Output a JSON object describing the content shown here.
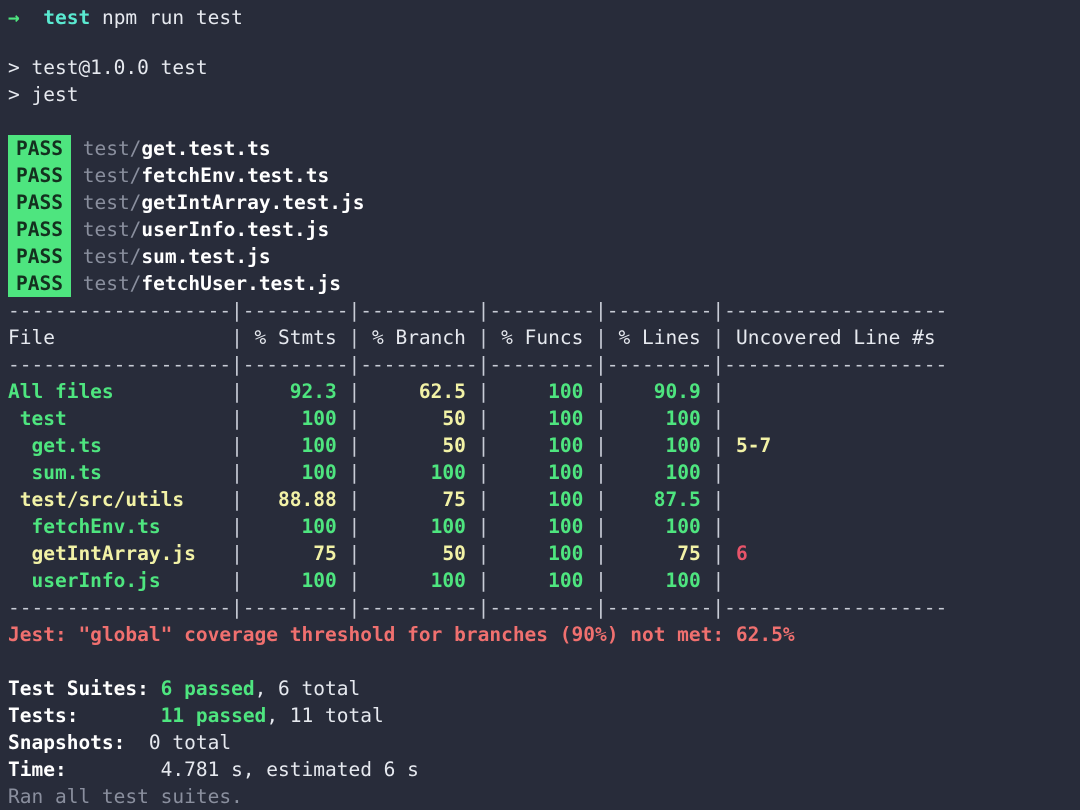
{
  "terminal": {
    "background_color": "#282c3a",
    "foreground_color": "#e6e9ef",
    "prompt": {
      "arrow_icon": "→",
      "cwd": "test",
      "command": "npm run test"
    },
    "npm_header": {
      "line1": "> test@1.0.0 test",
      "line2": "> jest"
    },
    "suites": [
      {
        "status": "PASS",
        "dir": "test/",
        "file": "get.test.ts"
      },
      {
        "status": "PASS",
        "dir": "test/",
        "file": "fetchEnv.test.ts"
      },
      {
        "status": "PASS",
        "dir": "test/",
        "file": "getIntArray.test.js"
      },
      {
        "status": "PASS",
        "dir": "test/",
        "file": "userInfo.test.js"
      },
      {
        "status": "PASS",
        "dir": "test/",
        "file": "sum.test.js"
      },
      {
        "status": "PASS",
        "dir": "test/",
        "file": "fetchUser.test.js"
      }
    ],
    "coverage_table": {
      "columns": [
        "File",
        "% Stmts",
        "% Branch",
        "% Funcs",
        "% Lines",
        "Uncovered Line #s"
      ],
      "separator_row": "-------------------|---------|----------|---------|---------|-------------------",
      "rows": [
        {
          "file": "All files",
          "indent": 0,
          "file_color": "green",
          "stmts": "92.3",
          "stmts_color": "green",
          "branch": "62.5",
          "branch_color": "yellow",
          "funcs": "100",
          "funcs_color": "green",
          "lines": "90.9",
          "lines_color": "green",
          "uncovered": "",
          "uncovered_color": "none"
        },
        {
          "file": "test",
          "indent": 1,
          "file_color": "green",
          "stmts": "100",
          "stmts_color": "green",
          "branch": "50",
          "branch_color": "yellow",
          "funcs": "100",
          "funcs_color": "green",
          "lines": "100",
          "lines_color": "green",
          "uncovered": "",
          "uncovered_color": "none"
        },
        {
          "file": "get.ts",
          "indent": 2,
          "file_color": "green",
          "stmts": "100",
          "stmts_color": "green",
          "branch": "50",
          "branch_color": "yellow",
          "funcs": "100",
          "funcs_color": "green",
          "lines": "100",
          "lines_color": "green",
          "uncovered": "5-7",
          "uncovered_color": "yellow"
        },
        {
          "file": "sum.ts",
          "indent": 2,
          "file_color": "green",
          "stmts": "100",
          "stmts_color": "green",
          "branch": "100",
          "branch_color": "green",
          "funcs": "100",
          "funcs_color": "green",
          "lines": "100",
          "lines_color": "green",
          "uncovered": "",
          "uncovered_color": "none"
        },
        {
          "file": "test/src/utils",
          "indent": 1,
          "file_color": "yellow",
          "stmts": "88.88",
          "stmts_color": "yellow",
          "branch": "75",
          "branch_color": "yellow",
          "funcs": "100",
          "funcs_color": "green",
          "lines": "87.5",
          "lines_color": "green",
          "uncovered": "",
          "uncovered_color": "none"
        },
        {
          "file": "fetchEnv.ts",
          "indent": 2,
          "file_color": "green",
          "stmts": "100",
          "stmts_color": "green",
          "branch": "100",
          "branch_color": "green",
          "funcs": "100",
          "funcs_color": "green",
          "lines": "100",
          "lines_color": "green",
          "uncovered": "",
          "uncovered_color": "none"
        },
        {
          "file": "getIntArray.js",
          "indent": 2,
          "file_color": "yellow",
          "stmts": "75",
          "stmts_color": "yellow",
          "branch": "50",
          "branch_color": "yellow",
          "funcs": "100",
          "funcs_color": "green",
          "lines": "75",
          "lines_color": "yellow",
          "uncovered": "6",
          "uncovered_color": "red"
        },
        {
          "file": "userInfo.js",
          "indent": 2,
          "file_color": "green",
          "stmts": "100",
          "stmts_color": "green",
          "branch": "100",
          "branch_color": "green",
          "funcs": "100",
          "funcs_color": "green",
          "lines": "100",
          "lines_color": "green",
          "uncovered": "",
          "uncovered_color": "none"
        }
      ]
    },
    "threshold_error": "Jest: \"global\" coverage threshold for branches (90%) not met: 62.5%",
    "summary": {
      "test_suites_label": "Test Suites:",
      "test_suites_passed": "6 passed",
      "test_suites_rest": ", 6 total",
      "tests_label": "Tests:",
      "tests_passed": "11 passed",
      "tests_rest": ", 11 total",
      "snapshots_label": "Snapshots:",
      "snapshots_value": "0 total",
      "time_label": "Time:",
      "time_value": "4.781 s, estimated 6 s",
      "ran_all": "Ran all test suites."
    },
    "colors": {
      "green": "#4ee57f",
      "yellow": "#f2f2a6",
      "red": "#e8546a",
      "error": "#f0706f",
      "dim": "#8a8f9e",
      "cyan": "#5ae9d0"
    }
  }
}
